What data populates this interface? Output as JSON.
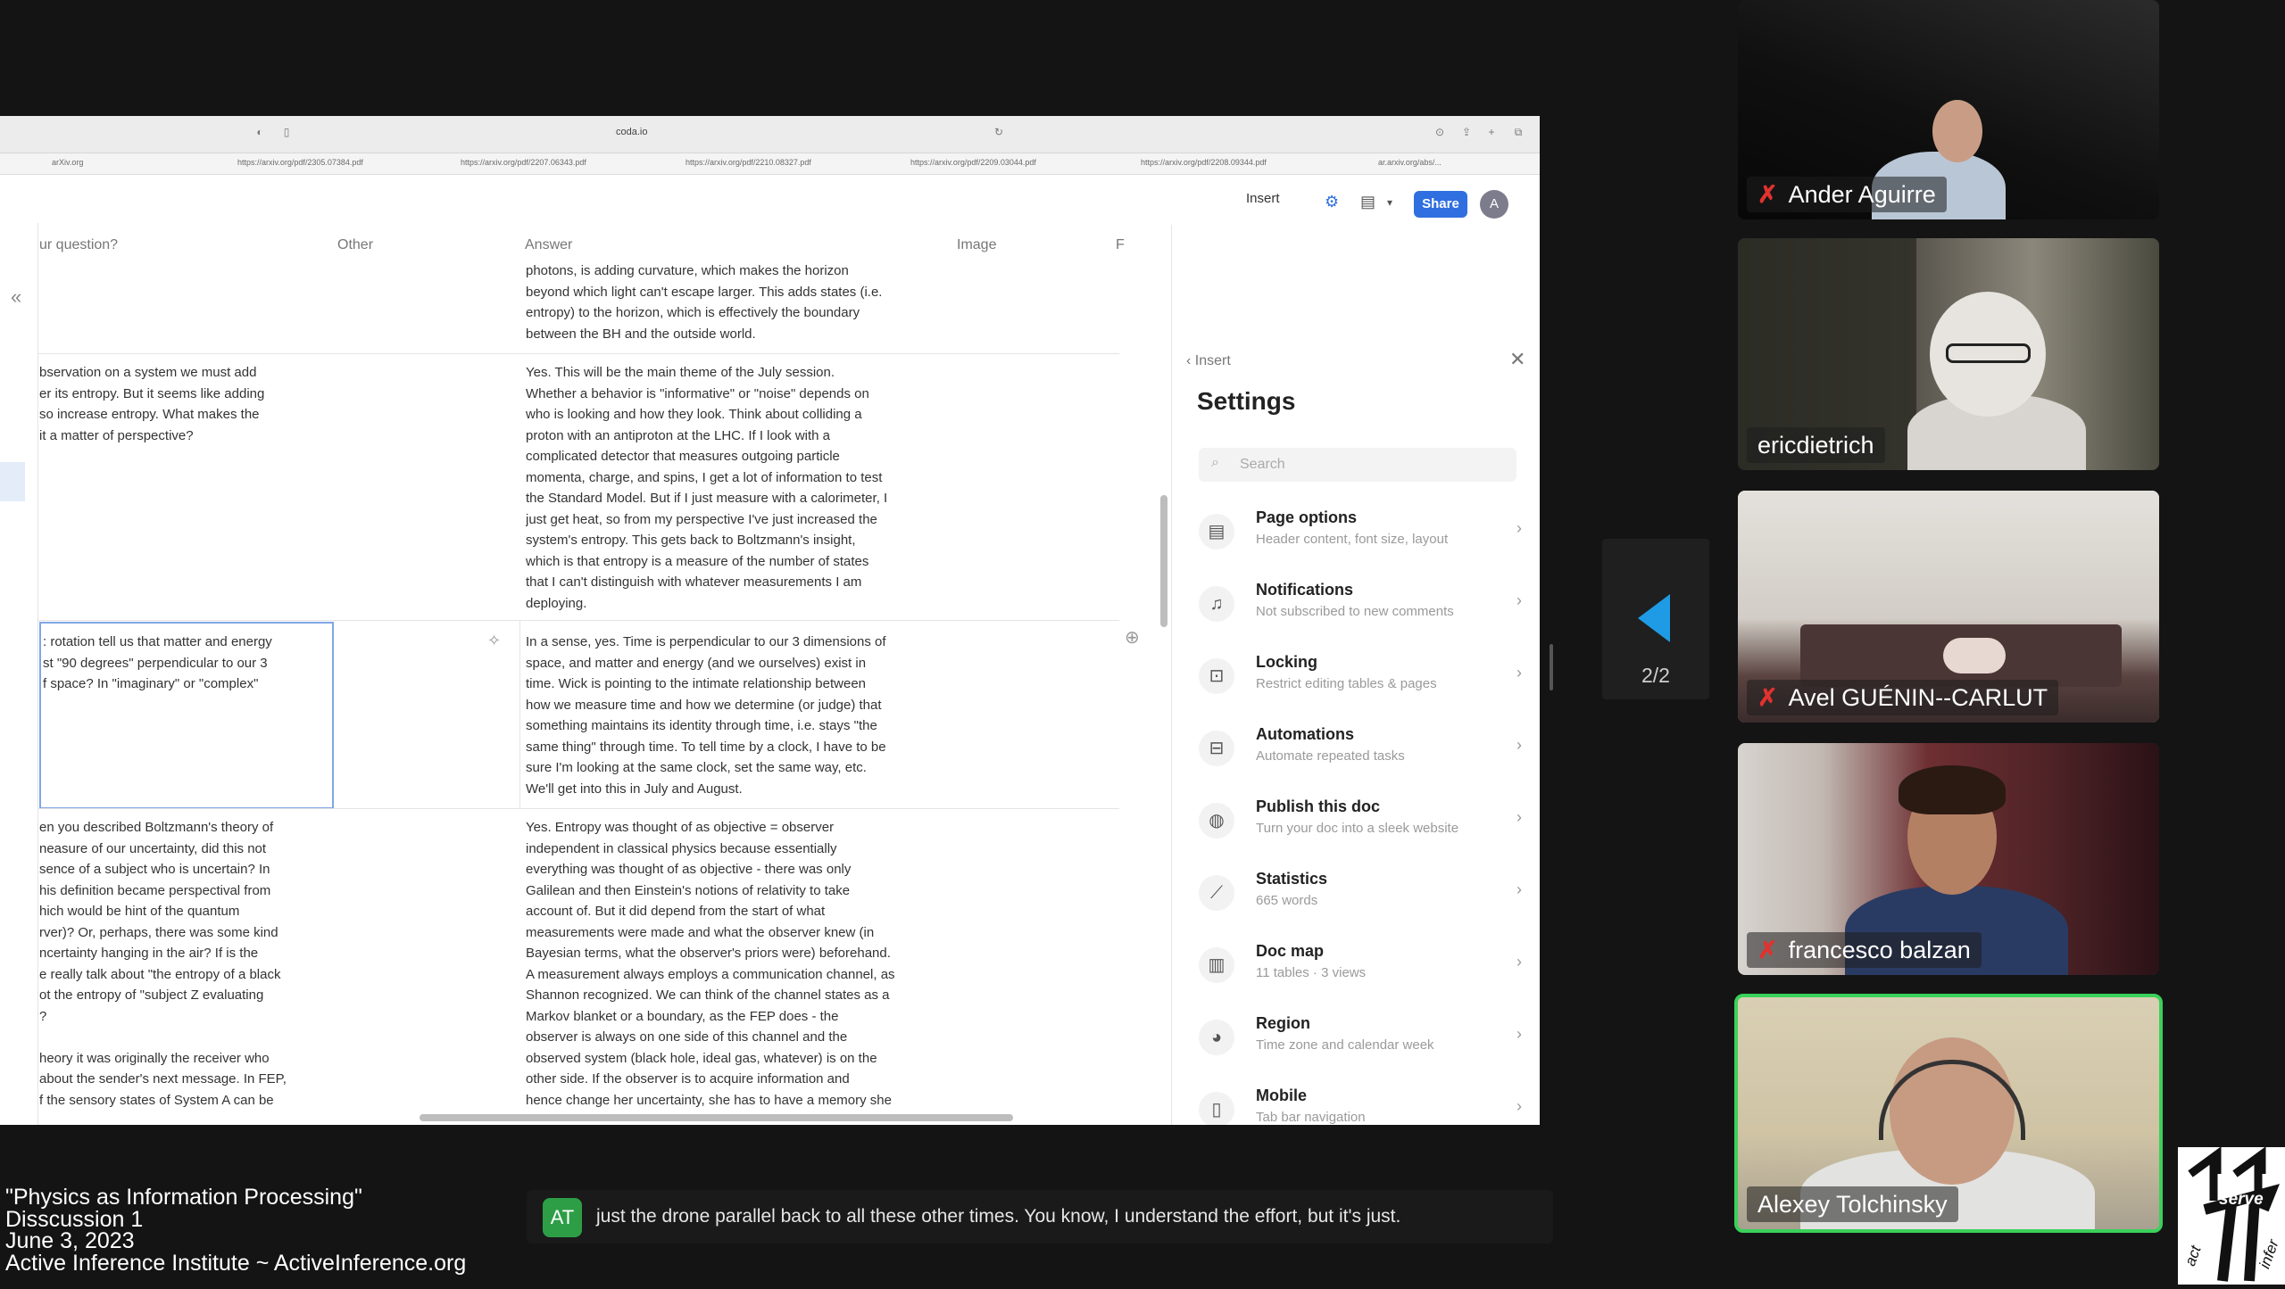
{
  "browser": {
    "url": "coda.io",
    "tabs": [
      "arXiv.org",
      "https://arxiv.org/pdf/2305.07384.pdf",
      "https://arxiv.org/pdf/2207.06343.pdf",
      "https://arxiv.org/pdf/2210.08327.pdf",
      "https://arxiv.org/pdf/2209.03044.pdf",
      "https://arxiv.org/pdf/2208.09344.pdf",
      "ar.arxiv.org/abs/..."
    ]
  },
  "toolbar": {
    "insert_label": "Insert",
    "share_label": "Share",
    "avatar_initial": "A"
  },
  "table": {
    "columns": [
      "ur question?",
      "Other",
      "Answer",
      "Image",
      "F"
    ],
    "rows": [
      {
        "question": "",
        "answer": "photons, is adding curvature, which makes the horizon\nbeyond which light can't escape larger.  This adds states (i.e.\nentropy) to the horizon, which is effectively the boundary\nbetween the BH and the outside world."
      },
      {
        "question": "bservation on a system we must add\ner its entropy. But it seems like adding\nso increase entropy. What makes the\n it a matter of perspective?",
        "answer": "Yes.  This will be the main theme of the July session.\nWhether a behavior is \"informative\" or \"noise\" depends on\nwho is looking and how they look.  Think about colliding a\nproton with an antiproton at the LHC.  If I look with a\ncomplicated detector that measures outgoing particle\nmomenta, charge, and spins, I get a lot of information to test\nthe Standard Model.  But if I just measure with a calorimeter, I\njust get heat, so from my perspective I've just increased the\nsystem's entropy.  This gets back to Boltzmann's insight,\nwhich is that entropy is a measure of the number of states\nthat I can't distinguish with whatever measurements I am\ndeploying."
      },
      {
        "question": ": rotation tell us that matter and energy\nst \"90 degrees\" perpendicular to our 3\nf space? In \"imaginary\" or \"complex\"",
        "answer": "In a sense, yes.  Time is perpendicular to our 3 dimensions of\nspace, and matter and energy (and we ourselves) exist in\ntime.  Wick is pointing to the intimate relationship between\nhow we measure time and how we determine (or judge) that\nsomething maintains its identity through time, i.e. stays \"the\nsame thing\" through time.  To tell time by a clock, I have to be\nsure I'm looking at the same clock, set the same way, etc.\nWe'll get into this in July and August."
      },
      {
        "question": "en you described Boltzmann's theory of\nneasure of our uncertainty, did this not\nsence of a subject who is uncertain? In\nhis definition became perspectival from\nhich would be hint of the quantum\nrver)?  Or, perhaps, there was some kind\nncertainty hanging in the air? If is the\ne really talk about \"the entropy of a black\not the entropy of \"subject Z evaluating\n?\n\nheory it was originally the receiver who\n about the sender's next message. In FEP,\nf the sensory states of System A can be",
        "answer": "Yes.  Entropy was thought of as objective = observer\nindependent in classical physics because essentially\neverything was thought of as objective - there was only\nGalilean and then Einstein's notions of relativity to take\naccount of.  But it did depend from the start of what\nmeasurements were made and what the observer knew (in\nBayesian terms, what the observer's priors were) beforehand.\nA measurement always employs a communication channel, as\nShannon recognized.  We can think of the channel states as a\nMarkov blanket or a boundary, as the FEP does - the\nobserver is always on one side of this channel and the\nobserved system (black hole, ideal gas, whatever) is on the\nother side.  If the observer is to acquire information and\nhence change her uncertainty, she has to have a memory she"
      }
    ]
  },
  "settings": {
    "back_label": "Insert",
    "title": "Settings",
    "search_placeholder": "Search",
    "items": [
      {
        "title": "Page options",
        "subtitle": "Header content, font size, layout",
        "icon": "page-icon"
      },
      {
        "title": "Notifications",
        "subtitle": "Not subscribed to new comments",
        "icon": "bell-icon"
      },
      {
        "title": "Locking",
        "subtitle": "Restrict editing tables & pages",
        "icon": "lock-icon"
      },
      {
        "title": "Automations",
        "subtitle": "Automate repeated tasks",
        "icon": "robot-icon"
      },
      {
        "title": "Publish this doc",
        "subtitle": "Turn your doc into a sleek website",
        "icon": "globe-icon"
      },
      {
        "title": "Statistics",
        "subtitle": "665 words",
        "icon": "chart-icon"
      },
      {
        "title": "Doc map",
        "subtitle": "11 tables · 3 views",
        "icon": "map-icon"
      },
      {
        "title": "Region",
        "subtitle": "Time zone and calendar week",
        "icon": "region-icon"
      },
      {
        "title": "Mobile",
        "subtitle": "Tab bar navigation",
        "icon": "mobile-icon"
      }
    ]
  },
  "pager": {
    "label": "2/2"
  },
  "participants": [
    {
      "name": "Ander Aguirre",
      "muted": true
    },
    {
      "name": "ericdietrich",
      "muted": false
    },
    {
      "name": "Avel GUÉNIN--CARLUT",
      "muted": true
    },
    {
      "name": "francesco balzan",
      "muted": true
    },
    {
      "name": "Alexey Tolchinsky",
      "muted": false,
      "speaking": true
    }
  ],
  "caption": {
    "initials": "AT",
    "text": "just the drone parallel back to all these other times. You know, I understand the effort, but it's just."
  },
  "event": {
    "line1": "\"Physics as Information Processing\"",
    "line2": "Disscussion 1",
    "line3": "June 3, 2023",
    "line4": "Active Inference Institute ~ ActiveInference.org"
  },
  "logo": {
    "text1": "serve",
    "text2": "act",
    "text3": "infer"
  },
  "colors": {
    "share": "#2f6fe0",
    "speaking_border": "#3ad15a",
    "mic_off": "#e0322f",
    "caption_avatar": "#2e9e46"
  }
}
